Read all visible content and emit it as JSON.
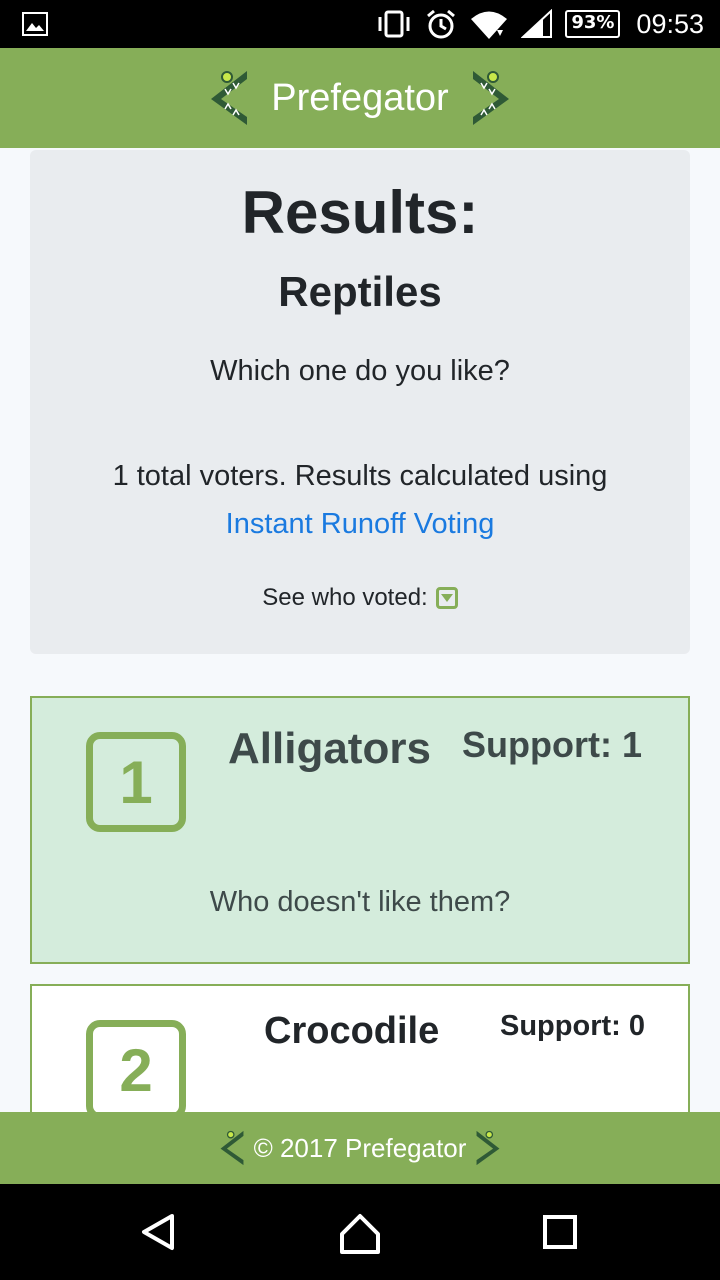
{
  "status_bar": {
    "battery": "93%",
    "time": "09:53",
    "icons": [
      "gallery-icon",
      "vibrate-icon",
      "alarm-icon",
      "wifi-icon",
      "signal-icon"
    ]
  },
  "header": {
    "title": "Prefegator",
    "logo_icon": "alligator-jaw-icon"
  },
  "results": {
    "heading": "Results:",
    "poll_name": "Reptiles",
    "question": "Which one do you like?",
    "voters_text": "1 total voters. Results calculated using",
    "method_link": "Instant Runoff Voting",
    "see_who_label": "See who voted:"
  },
  "candidates": [
    {
      "rank": "1",
      "name": "Alligators",
      "support": "Support: 1",
      "dislike_link": "Who doesn't like them?"
    },
    {
      "rank": "2",
      "name": "Crocodile",
      "support": "Support: 0"
    }
  ],
  "footer": {
    "text": "© 2017 Prefegator"
  },
  "colors": {
    "brand_green": "#86ae58",
    "winner_bg": "#d4ecdc",
    "link_blue": "#1a7ae0",
    "summary_bg": "#e9ecef"
  }
}
